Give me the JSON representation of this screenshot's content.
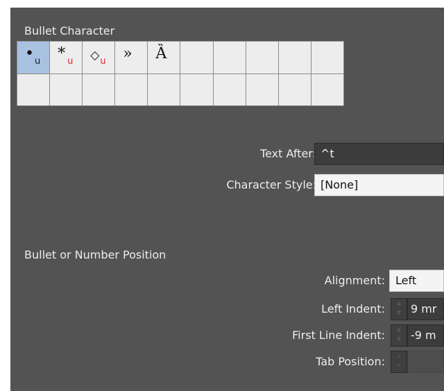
{
  "bullet_character": {
    "label": "Bullet Character",
    "cells": [
      {
        "glyph": "•",
        "sub": "u",
        "selected": true
      },
      {
        "glyph": "*",
        "sub": "u",
        "selected": false
      },
      {
        "glyph": "◇",
        "sub": "u",
        "selected": false
      },
      {
        "glyph": "»",
        "sub": "",
        "selected": false
      },
      {
        "glyph": "Ȁ",
        "sub": "",
        "selected": false
      }
    ]
  },
  "text_after": {
    "label": "Text After:",
    "value": "^t"
  },
  "character_style": {
    "label": "Character Style:",
    "value": "[None]"
  },
  "position_section": {
    "label": "Bullet or Number Position"
  },
  "alignment": {
    "label": "Alignment:",
    "value": "Left"
  },
  "left_indent": {
    "label": "Left Indent:",
    "value": "9 mr"
  },
  "first_line_indent": {
    "label": "First Line Indent:",
    "value": "-9 m"
  },
  "tab_position": {
    "label": "Tab Position:",
    "value": ""
  }
}
